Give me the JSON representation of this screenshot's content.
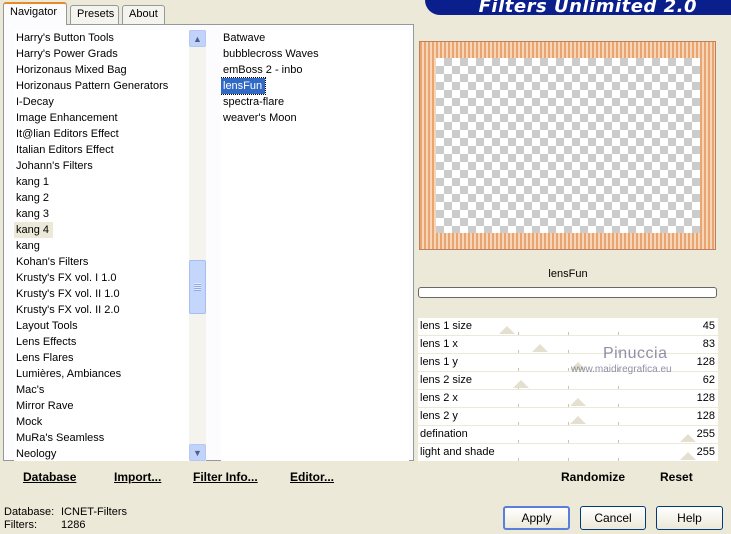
{
  "tabs": [
    "Navigator",
    "Presets",
    "About"
  ],
  "banner_title": "Filters Unlimited 2.0",
  "categories": [
    "Harry's Button Tools",
    "Harry's Power Grads",
    "Horizonaus Mixed Bag",
    "Horizonaus Pattern Generators",
    "I-Decay",
    "Image Enhancement",
    "It@lian Editors Effect",
    "Italian Editors Effect",
    "Johann's Filters",
    "kang 1",
    "kang 2",
    "kang 3",
    "kang 4",
    "kang",
    "Kohan's Filters",
    "Krusty's FX vol. I 1.0",
    "Krusty's FX vol. II 1.0",
    "Krusty's FX vol. II 2.0",
    "Layout Tools",
    "Lens Effects",
    "Lens Flares",
    "Lumières, Ambiances",
    "Mac's",
    "Mirror Rave",
    "Mock",
    "MuRa's Seamless",
    "Neology"
  ],
  "selected_category": "kang 4",
  "filters": [
    "Batwave",
    "bubblecross Waves",
    "emBoss 2 -  inbo",
    "lensFun",
    "spectra-flare",
    "weaver's Moon"
  ],
  "selected_filter": "lensFun",
  "left_buttons": {
    "database": "Database",
    "import": "Import...",
    "filter_info": "Filter Info...",
    "editor": "Editor..."
  },
  "effect_name": "lensFun",
  "params": [
    {
      "label": "lens 1 size",
      "value": "45",
      "level": 45
    },
    {
      "label": "lens 1 x",
      "value": "83",
      "level": 83
    },
    {
      "label": "lens 1 y",
      "value": "128",
      "level": 128
    },
    {
      "label": "lens 2 size",
      "value": "62",
      "level": 62
    },
    {
      "label": "lens 2 x",
      "value": "128",
      "level": 128
    },
    {
      "label": "lens 2 y",
      "value": "128",
      "level": 128
    },
    {
      "label": "defination",
      "value": "255",
      "level": 255
    },
    {
      "label": "light and shade",
      "value": "255",
      "level": 255
    }
  ],
  "param_max": 255,
  "watermark": {
    "name": "Pinuccia",
    "site": "www.maidiregrafica.eu"
  },
  "right_buttons": {
    "randomize": "Randomize",
    "reset": "Reset"
  },
  "footer": {
    "database_label": "Database:",
    "database_value": "ICNET-Filters",
    "filters_label": "Filters:",
    "filters_value": "1286"
  },
  "dialog_buttons": {
    "apply": "Apply",
    "cancel": "Cancel",
    "help": "Help"
  },
  "colors": {
    "selection": "#316ac5",
    "banner": "#0a1e8c",
    "dialog_bg": "#ece9d8"
  }
}
